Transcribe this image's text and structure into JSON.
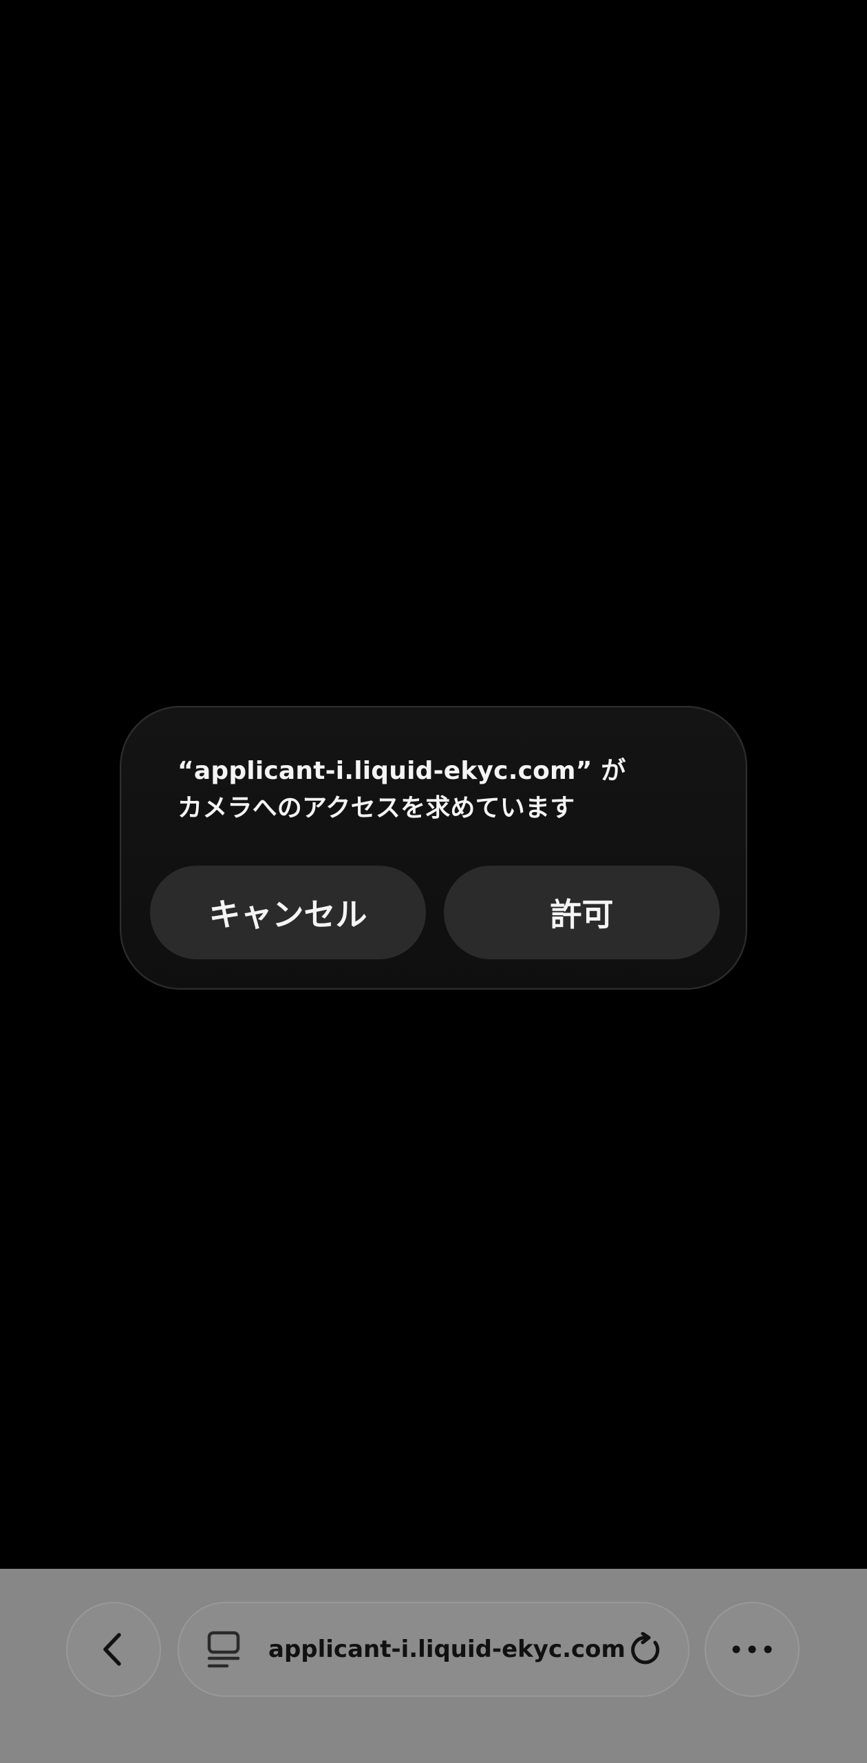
{
  "dialog": {
    "message_line1": "“applicant-i.liquid-ekyc.com” が",
    "message_line2": "カメラへのアクセスを求めています",
    "cancel_label": "キャンセル",
    "allow_label": "許可"
  },
  "toolbar": {
    "back_icon": "chevron-left-icon",
    "tab_icon": "tab-overview-icon",
    "address_text": "applicant-i.liquid-ekyc.com",
    "reload_icon": "reload-icon",
    "more_icon": "ellipsis-icon"
  },
  "colors": {
    "background": "#000000",
    "dialog_background": "#121212",
    "button_background": "#2b2b2b",
    "toolbar_background": "#878787",
    "text_light": "#f4f4f4",
    "text_dark": "#111111"
  }
}
